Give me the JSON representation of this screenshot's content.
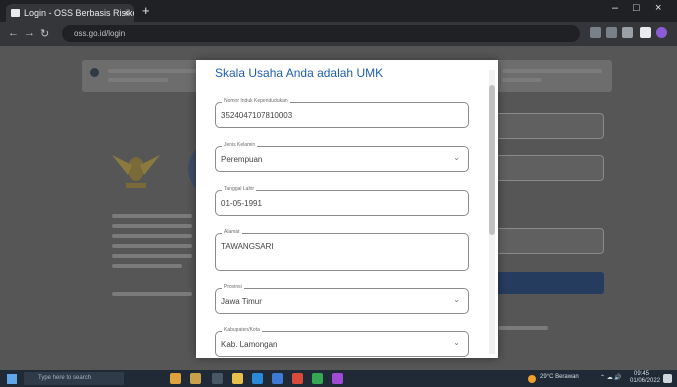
{
  "browser": {
    "tab_title": "Login - OSS Berbasis Risiko",
    "tab_close": "×",
    "new_tab": "+",
    "url": "oss.go.id/login",
    "win_min": "–",
    "win_max": "□",
    "win_close": "×"
  },
  "modal": {
    "title": "Skala Usaha Anda adalah UMK",
    "fields": [
      {
        "label": "Nomor Induk Kependudukan",
        "value": "3524047107810003",
        "type": "text"
      },
      {
        "label": "Jenis Kelamin",
        "value": "Perempuan",
        "type": "select"
      },
      {
        "label": "Tanggal Lahir",
        "value": "01-05-1991",
        "type": "text"
      },
      {
        "label": "Alamat",
        "value": "TAWANGSARI",
        "type": "textarea"
      },
      {
        "label": "Provinsi",
        "value": "Jawa Timur",
        "type": "select"
      },
      {
        "label": "Kabupaten/Kota",
        "value": "Kab. Lamongan",
        "type": "select"
      }
    ],
    "chevron": "⌄"
  },
  "taskbar": {
    "search_placeholder": "Type here to search",
    "weather": "29°C Berawan",
    "time": "09:45",
    "date": "01/06/2022"
  },
  "colors": {
    "title_blue": "#1f5fae",
    "overlay": "#565656",
    "primary_button": "#253c5e"
  }
}
